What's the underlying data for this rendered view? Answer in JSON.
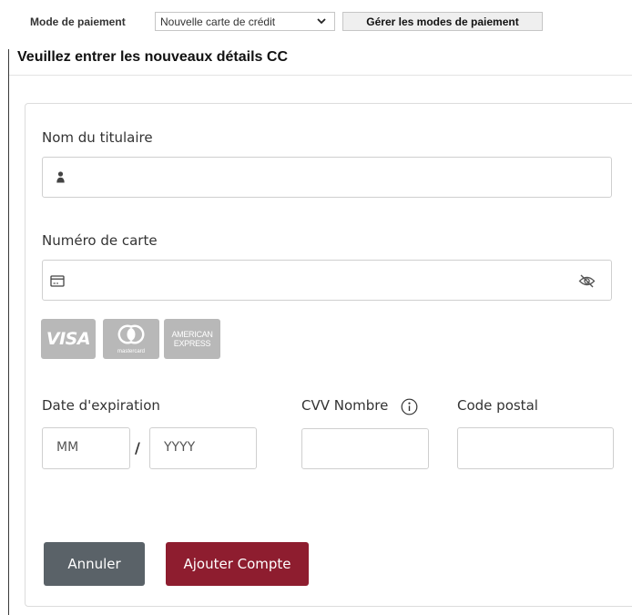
{
  "toolbar": {
    "payment_mode_label": "Mode de paiement",
    "payment_mode_selected": "Nouvelle carte de crédit",
    "manage_button": "Gérer les modes de paiement"
  },
  "section_title": "Veuillez entrer les nouveaux détails CC",
  "form": {
    "holder_label": "Nom du titulaire",
    "holder_value": "",
    "card_number_label": "Numéro de carte",
    "card_number_value": "",
    "card_brands": {
      "visa": "VISA",
      "mastercard": "mastercard",
      "amex_line1": "AMERICAN",
      "amex_line2": "EXPRESS"
    },
    "expiry_label": "Date d'expiration",
    "expiry_separator": "/",
    "month_placeholder": "MM",
    "year_placeholder": "YYYY",
    "cvv_label": "CVV Nombre",
    "postal_label": "Code postal"
  },
  "buttons": {
    "cancel": "Annuler",
    "add": "Ajouter Compte"
  },
  "colors": {
    "cancel_button": "#5a6268",
    "add_button": "#8e1d2f",
    "brand_logos": "#b8b8b8"
  },
  "icons": [
    "chevron-down-icon",
    "user-icon",
    "credit-card-icon",
    "eye-slash-icon",
    "info-icon"
  ]
}
